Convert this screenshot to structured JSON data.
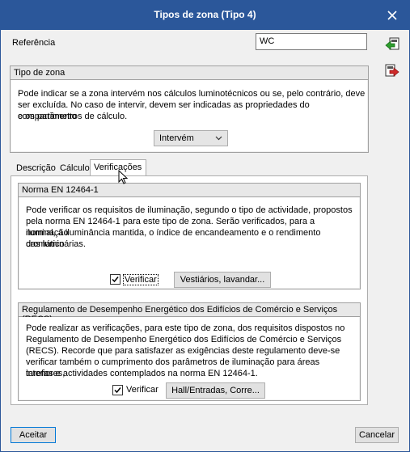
{
  "window": {
    "title": "Tipos de zona (Tipo 4)"
  },
  "referencia": {
    "label": "Referência",
    "value": "WC"
  },
  "tipo_zona": {
    "header": "Tipo de zona",
    "description_lines": [
      "Pode indicar se a zona intervém nos cálculos luminotécnicos ou se, pelo contrário, deve",
      "ser excluída. No caso de intervir, devem ser indicadas as propriedades do compartimento",
      "e os parâmetros de cálculo."
    ],
    "select_value": "Intervém"
  },
  "tabs": [
    {
      "label": "Descrição"
    },
    {
      "label": "Cálculo"
    },
    {
      "label": "Verificações"
    }
  ],
  "norma": {
    "header": "Norma EN 12464-1",
    "lines": [
      "Pode verificar os requisitos de iluminação, segundo o tipo de actividade, propostos",
      "pela norma EN 12464-1 para este tipo de zona. Serão verificados, para a iluminação",
      "normal, a iluminância mantida, o índice de encandeamento e o rendimento cromático",
      "das luminárias."
    ],
    "check_label": "Verificar",
    "button_label": "Vestiários, lavandar..."
  },
  "recs": {
    "header": "Regulamento de Desempenho Energético dos Edifícios de Comércio e Serviços (RECS)",
    "lines": [
      "Pode realizar as verificações, para este tipo de zona, dos requisitos dispostos no",
      "Regulamento de Desempenho Energético dos Edifícios de Comércio e Serviços",
      "(RECS). Recorde que para satisfazer as exigências deste regulamento deve-se",
      "verificar também o cumprimento dos parâmetros de iluminação para áreas interiores,",
      "tarefas e actividades contemplados na norma EN 12464-1."
    ],
    "check_label": "Verificar",
    "button_label": "Hall/Entradas, Corre..."
  },
  "footer": {
    "accept": "Aceitar",
    "cancel": "Cancelar"
  }
}
